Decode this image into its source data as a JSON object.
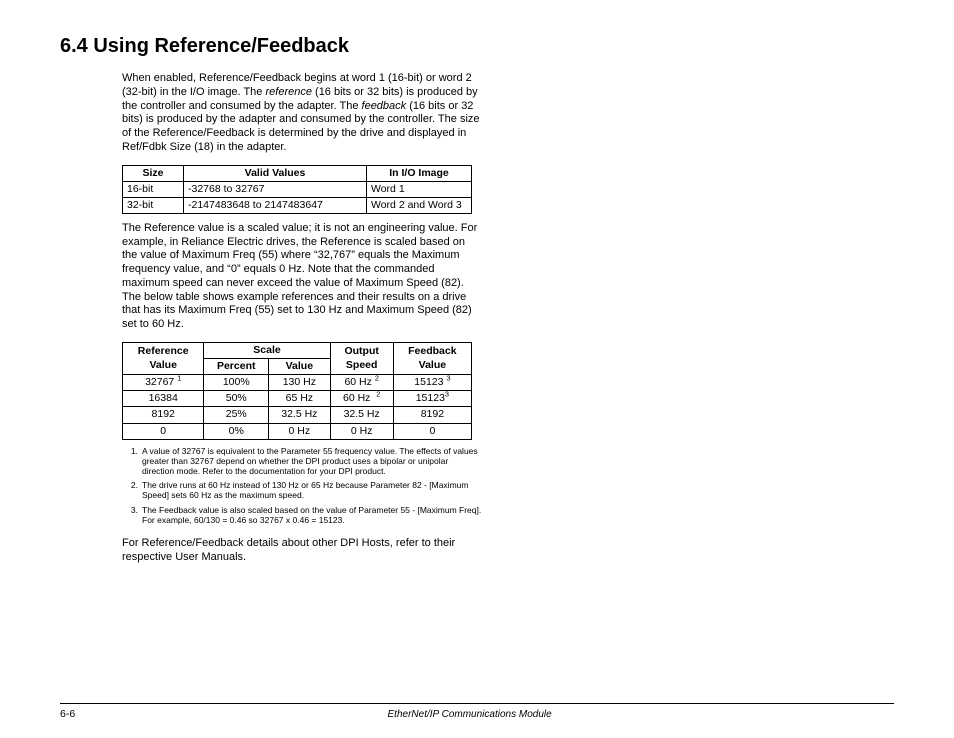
{
  "heading": "6.4   Using Reference/Feedback",
  "para1_a": "When enabled, Reference/Feedback begins at word 1 (16-bit) or word 2 (32-bit) in the I/O image. The ",
  "para1_ref": "reference",
  "para1_b": " (16 bits or 32 bits) is produced by the controller and consumed by the adapter. The ",
  "para1_fb": "feedback",
  "para1_c": " (16 bits or 32 bits) is produced by the adapter and consumed by the controller. The size of the Reference/Feedback is determined by the drive and displayed in Ref/Fdbk Size (18) in the adapter.",
  "t1": {
    "h": [
      "Size",
      "Valid Values",
      "In I/O Image"
    ],
    "r1": [
      "16-bit",
      "-32768 to 32767",
      "Word 1"
    ],
    "r2": [
      "32-bit",
      "-2147483648 to 2147483647",
      "Word 2 and Word 3"
    ]
  },
  "para2": "The Reference value is a scaled value; it is not an engineering value. For example, in Reliance Electric drives, the Reference is scaled based on the value of Maximum Freq (55) where “32,767” equals the Maximum frequency value, and “0” equals 0 Hz. Note that the commanded maximum speed can never exceed the value of Maximum Speed (82). The below table shows example references and their results on a drive that has its Maximum Freq (55) set to 130 Hz and Maximum Speed (82) set to 60 Hz.",
  "t2": {
    "h_top": [
      "Reference",
      "Scale",
      "Output",
      "Feedback"
    ],
    "h_sub": [
      "Value",
      "Percent",
      "Value",
      "Speed",
      "Value"
    ],
    "r1": [
      "32767",
      "1",
      "100%",
      "130 Hz",
      "60 Hz",
      "2",
      "15123",
      "3"
    ],
    "r2": [
      "16384",
      "50%",
      "65 Hz",
      "60 Hz",
      "2",
      "15123",
      "3"
    ],
    "r3": [
      "8192",
      "25%",
      "32.5 Hz",
      "32.5 Hz",
      "8192"
    ],
    "r4": [
      "0",
      "0%",
      "0 Hz",
      "0 Hz",
      "0"
    ]
  },
  "notes": {
    "n1": "A value of 32767 is equivalent to the Parameter 55 frequency value. The effects of values greater than 32767 depend on whether the DPI product uses a bipolar or unipolar direction mode. Refer to the documentation for your DPI product.",
    "n2": "The drive runs at 60 Hz instead of 130 Hz or 65 Hz because Parameter 82 - [Maximum Speed] sets 60 Hz as the maximum speed.",
    "n3": "The Feedback value is also scaled based on the value of Parameter 55 - [Maximum Freq]. For example, 60/130 = 0.46 so 32767 x 0.46 = 15123."
  },
  "para3": "For Reference/Feedback details about other DPI Hosts, refer to their respective User Manuals.",
  "footer": {
    "page": "6-6",
    "doc": "EtherNet/IP Communications Module"
  }
}
